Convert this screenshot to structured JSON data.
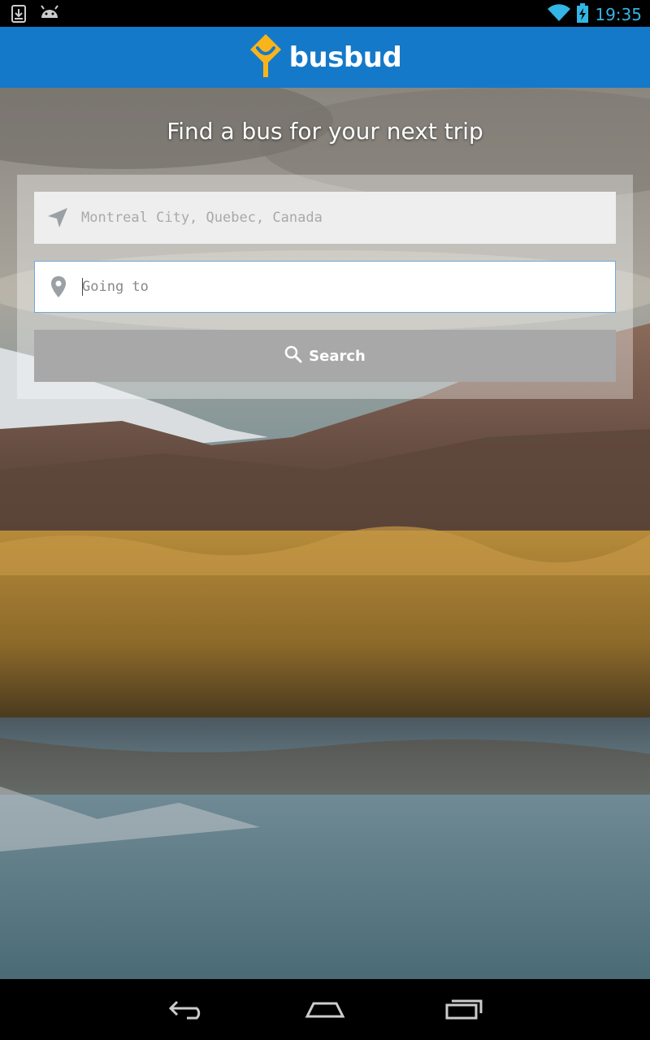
{
  "status_bar": {
    "time": "19:35"
  },
  "app_bar": {
    "brand": "busbud"
  },
  "headline": "Find a bus for your next trip",
  "search": {
    "from_value": "Montreal City, Quebec, Canada",
    "to_placeholder": "Going to",
    "button_label": "Search"
  },
  "icons": {
    "download": "download-icon",
    "android": "android-icon",
    "wifi": "wifi-icon",
    "battery": "battery-charging-icon",
    "location": "location-arrow-icon",
    "pin": "map-pin-icon",
    "search": "search-icon",
    "back": "back-icon",
    "home": "home-icon",
    "recents": "recents-icon"
  },
  "colors": {
    "brand": "#1479c9",
    "logo": "#f9b41a",
    "status_accent": "#33b5e5"
  }
}
